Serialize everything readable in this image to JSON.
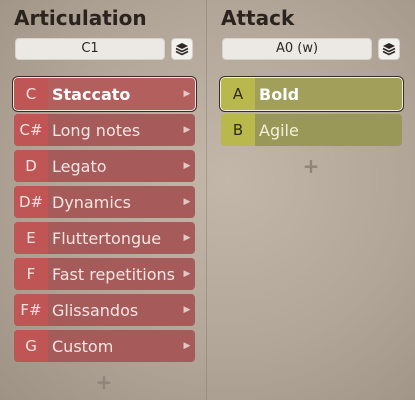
{
  "articulation": {
    "title": "Articulation",
    "key_field": "C1",
    "items": [
      {
        "key": "C",
        "label": "Staccato",
        "selected": true
      },
      {
        "key": "C#",
        "label": "Long notes"
      },
      {
        "key": "D",
        "label": "Legato"
      },
      {
        "key": "D#",
        "label": "Dynamics"
      },
      {
        "key": "E",
        "label": "Fluttertongue"
      },
      {
        "key": "F",
        "label": "Fast repetitions"
      },
      {
        "key": "F#",
        "label": "Glissandos"
      },
      {
        "key": "G",
        "label": "Custom"
      }
    ],
    "add_label": "+"
  },
  "attack": {
    "title": "Attack",
    "key_field": "A0 (w)",
    "items": [
      {
        "key": "A",
        "label": "Bold",
        "selected": true
      },
      {
        "key": "B",
        "label": "Agile"
      }
    ],
    "add_label": "+"
  },
  "icons": {
    "layers": "layers-icon",
    "chevron": "chevron-right-icon",
    "add": "plus-icon"
  },
  "colors": {
    "articulation_item": "#a65a59",
    "articulation_key": "#c05555",
    "attack_item": "#9a9858",
    "attack_key": "#b9b84d"
  }
}
